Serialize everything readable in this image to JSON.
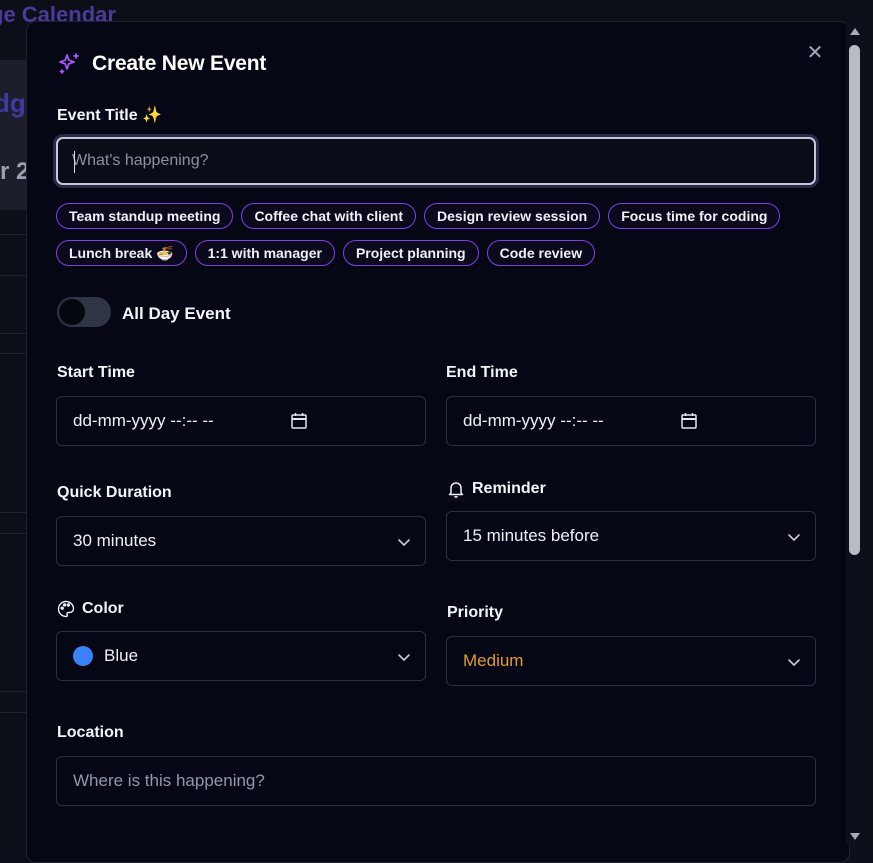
{
  "background": {
    "app_title_fragment": "ge Calendar",
    "panel_text_1": "dg",
    "panel_text_2": "r 2"
  },
  "modal": {
    "title": "Create New Event",
    "close_symbol": "✕",
    "header_icon": "sparkles-icon"
  },
  "event_title": {
    "label": "Event Title ✨",
    "placeholder": "What's happening?",
    "value": ""
  },
  "suggestions": [
    [
      "Team standup meeting",
      "Coffee chat with client",
      "Design review session",
      "Focus time for coding"
    ],
    [
      "Lunch break 🍜",
      "1:1 with manager",
      "Project planning",
      "Code review"
    ]
  ],
  "all_day": {
    "label": "All Day Event",
    "enabled": false
  },
  "start_time": {
    "label": "Start Time",
    "value": "dd-mm-yyyy --:-- --"
  },
  "end_time": {
    "label": "End Time",
    "value": "dd-mm-yyyy --:-- --"
  },
  "quick_duration": {
    "label": "Quick Duration",
    "value": "30 minutes"
  },
  "reminder": {
    "label": "Reminder",
    "icon": "bell-icon",
    "value": "15 minutes before"
  },
  "color": {
    "label": "Color",
    "icon": "palette-icon",
    "value": "Blue",
    "swatch": "#3b82f6"
  },
  "priority": {
    "label": "Priority",
    "value": "Medium",
    "value_color": "#e39a2c"
  },
  "location": {
    "label": "Location",
    "placeholder": "Where is this happening?",
    "value": ""
  },
  "colors": {
    "accent": "#7e3ee3",
    "modal_bg": "#050814"
  }
}
